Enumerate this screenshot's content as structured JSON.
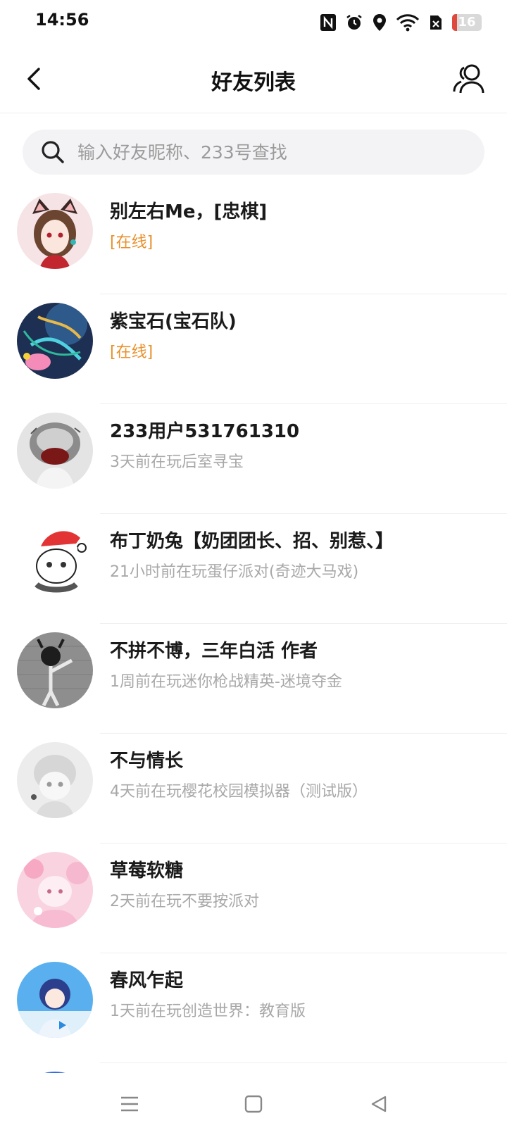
{
  "status_bar": {
    "time": "14:56",
    "icons": [
      "nfc-icon",
      "alarm-icon",
      "location-icon",
      "wifi-icon",
      "sim-off-icon",
      "battery-icon"
    ],
    "battery_level": "16",
    "battery_fraction": 0.16,
    "battery_color": "#e0483d"
  },
  "header": {
    "title": "好友列表",
    "back_icon": "back-arrow-icon",
    "right_icon": "friends-icon"
  },
  "search": {
    "placeholder": "输入好友昵称、233号查找",
    "value": ""
  },
  "colors": {
    "online": "#e8912d",
    "offline": "#a8a8a8"
  },
  "friends": [
    {
      "name": "别左右Me，[忠棋]",
      "status": "[在线]",
      "online": true
    },
    {
      "name": "紫宝石(宝石队)",
      "status": "[在线]",
      "online": true
    },
    {
      "name": "233用户531761310",
      "status": "3天前在玩后室寻宝",
      "online": false
    },
    {
      "name": "布丁奶兔【奶团团长、招、别惹、】",
      "status": "21小时前在玩蛋仔派对(奇迹大马戏)",
      "online": false
    },
    {
      "name": "不拼不博，三年白活 作者",
      "status": "1周前在玩迷你枪战精英-迷境夺金",
      "online": false
    },
    {
      "name": "不与情长",
      "status": "4天前在玩樱花校园模拟器（测试版）",
      "online": false
    },
    {
      "name": "草莓软糖",
      "status": "2天前在玩不要按派对",
      "online": false
    },
    {
      "name": "春风乍起",
      "status": "1天前在玩创造世界：教育版",
      "online": false
    }
  ],
  "nav_bar": {
    "icons": [
      "menu-icon",
      "home-icon",
      "back-triangle-icon"
    ]
  }
}
